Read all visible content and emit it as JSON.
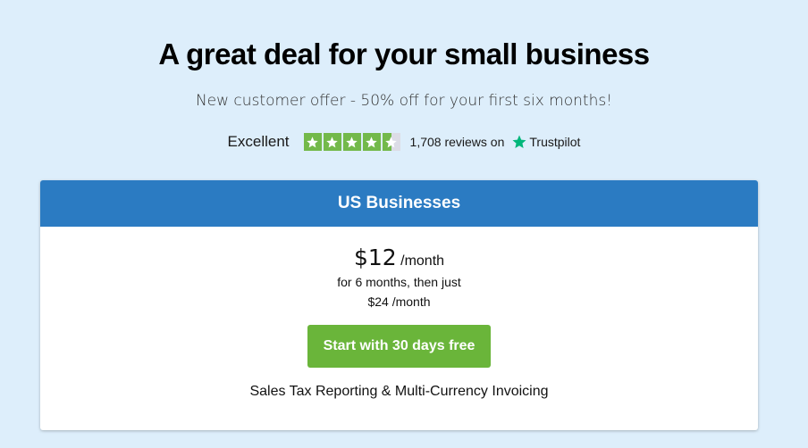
{
  "hero": {
    "title": "A great deal for your small business",
    "subtitle": "New customer offer - 50% off for your first six months!"
  },
  "trustpilot": {
    "rating_word": "Excellent",
    "stars_filled": 4.5,
    "stars_total": 5,
    "review_text": "1,708 reviews on",
    "brand": "Trustpilot",
    "star_color": "#73b94a",
    "brand_star_color": "#00b67a"
  },
  "plan": {
    "header": "US Businesses",
    "price": "$12",
    "price_unit": "/month",
    "intro_note": "for 6 months, then just",
    "regular_price": "$24 /month",
    "cta_label": "Start with 30 days free",
    "features": "Sales Tax Reporting & Multi-Currency Invoicing"
  },
  "colors": {
    "background": "#ddeefb",
    "header_blue": "#2b7bc2",
    "cta_green": "#6ab53a"
  }
}
